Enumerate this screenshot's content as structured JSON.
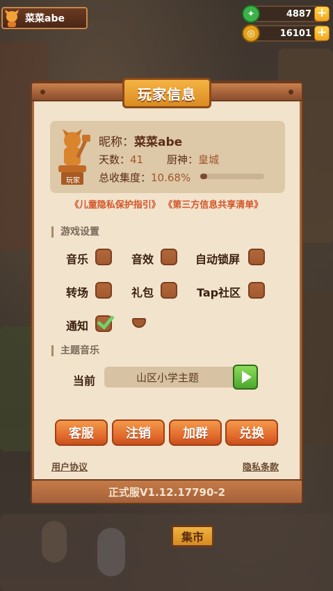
{
  "hud": {
    "player_name": "菜菜abe",
    "resources": [
      {
        "icon": "green-gem-icon",
        "value": "4887",
        "color": "#3bb34a"
      },
      {
        "icon": "gold-coin-icon",
        "value": "16101",
        "color": "#e3a21a"
      }
    ],
    "plus_label": "+"
  },
  "panel": {
    "title": "玩家信息",
    "badge_label": "玩家",
    "nickname_label": "昵称：",
    "nickname": "菜菜abe",
    "days_label": "天数：",
    "days": "41",
    "chef_label": "厨神：",
    "chef": "皇城",
    "collection_label": "总收集度：",
    "collection": "10.68%",
    "collection_fraction": 0.1068,
    "link_privacy": "《儿童隐私保护指引》",
    "link_thirdparty": "《第三方信息共享清单》"
  },
  "settings": {
    "heading": "游戏设置",
    "options": [
      {
        "label": "音乐",
        "checked": false
      },
      {
        "label": "音效",
        "checked": false
      },
      {
        "label": "自动锁屏",
        "checked": false
      },
      {
        "label": "转场",
        "checked": false
      },
      {
        "label": "礼包",
        "checked": false
      },
      {
        "label": "Tap社区",
        "checked": false
      },
      {
        "label": "通知",
        "checked": true
      }
    ]
  },
  "music": {
    "heading": "主题音乐",
    "current_label": "当前",
    "current_track": "山区小学主题"
  },
  "actions": [
    "客服",
    "注销",
    "加群",
    "兑换"
  ],
  "footer": {
    "user_agreement": "用户协议",
    "privacy_terms": "隐私条款",
    "version": "正式服V1.12.17790-2"
  },
  "scene": {
    "market_sign": "集市"
  }
}
